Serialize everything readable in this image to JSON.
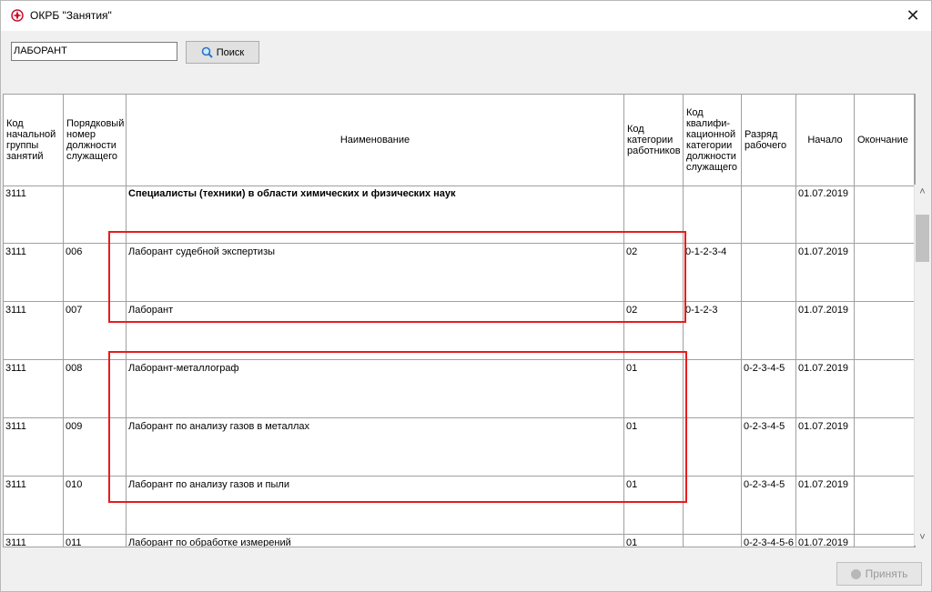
{
  "window": {
    "title": "ОКРБ \"Занятия\""
  },
  "search": {
    "value": "ЛАБОРАНТ",
    "button_label": "Поиск"
  },
  "columns": [
    "Код\nначальной\nгруппы\nзанятий",
    "Порядковый\n номер\nдолжности\nслужащего",
    "Наименование",
    "Код\nкатегории\nработников",
    "Код\nквалифи-\nкационной\nкатегории\nдолжности\nслужащего",
    "Разряд\nрабочего",
    "Начало",
    "Окончание"
  ],
  "rows": [
    {
      "group": "3111",
      "num": "",
      "name": "Специалисты (техники) в области химических и физических наук",
      "cat": "",
      "qual": "",
      "grade": "",
      "start": "01.07.2019",
      "end": "",
      "bold": true
    },
    {
      "group": "3111",
      "num": "006",
      "name": "Лаборант судебной экспертизы",
      "cat": "02",
      "qual": "0-1-2-3-4",
      "grade": "",
      "start": "01.07.2019",
      "end": ""
    },
    {
      "group": "3111",
      "num": "007",
      "name": "Лаборант",
      "cat": "02",
      "qual": "0-1-2-3",
      "grade": "",
      "start": "01.07.2019",
      "end": ""
    },
    {
      "group": "3111",
      "num": "008",
      "name": "Лаборант-металлограф",
      "cat": "01",
      "qual": "",
      "grade": "0-2-3-4-5",
      "start": "01.07.2019",
      "end": ""
    },
    {
      "group": "3111",
      "num": "009",
      "name": "Лаборант по анализу газов в металлах",
      "cat": "01",
      "qual": "",
      "grade": "0-2-3-4-5",
      "start": "01.07.2019",
      "end": ""
    },
    {
      "group": "3111",
      "num": "010",
      "name": "Лаборант по анализу газов и пыли",
      "cat": "01",
      "qual": "",
      "grade": "0-2-3-4-5",
      "start": "01.07.2019",
      "end": ""
    },
    {
      "group": "3111",
      "num": "011",
      "name": "Лаборант по обработке измерений",
      "cat": "01",
      "qual": "",
      "grade": "0-2-3-4-5-6",
      "start": "01.07.2019",
      "end": ""
    }
  ],
  "footer": {
    "accept_label": "Принять"
  },
  "colors": {
    "highlight": "#e81c1c",
    "app_icon": "#c8102e"
  },
  "icons": {
    "app": "app-icon",
    "close": "close-icon",
    "search": "search-icon",
    "accept": "accept-icon"
  }
}
